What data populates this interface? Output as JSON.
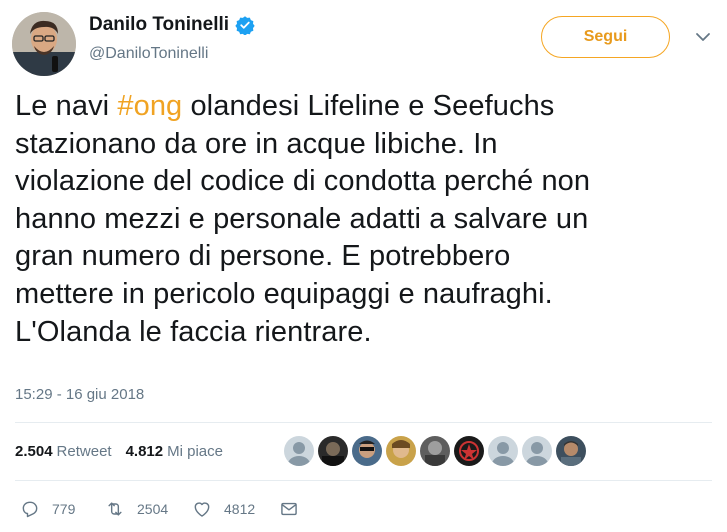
{
  "author": {
    "name": "Danilo Toninelli",
    "handle": "@DaniloToninelli"
  },
  "follow_label": "Segui",
  "tweet": {
    "text_before": "Le navi ",
    "hashtag": "#ong",
    "text_after": " olandesi Lifeline e Seefuchs\nstazionano da ore in acque libiche. In\nviolazione del codice di condotta perché non\nhanno mezzi e personale adatti a salvare un\ngran numero di persone. E potrebbero\nmettere in pericolo equipaggi e naufraghi.\nL'Olanda le faccia rientrare."
  },
  "timestamp": "15:29 - 16 giu 2018",
  "stats": {
    "retweet_count": "2.504",
    "retweet_label": "Retweet",
    "like_count": "4.812",
    "like_label": "Mi piace"
  },
  "actions": {
    "reply_count": "779",
    "retweet_count": "2504",
    "like_count": "4812"
  },
  "colors": {
    "accent": "#f0a323",
    "text": "#14171a",
    "muted": "#657786",
    "divider": "#e6ecf0",
    "verified": "#1da1f2"
  },
  "icons": [
    "verified-badge-icon",
    "chevron-down-icon",
    "reply-icon",
    "retweet-icon",
    "heart-icon",
    "envelope-icon"
  ]
}
